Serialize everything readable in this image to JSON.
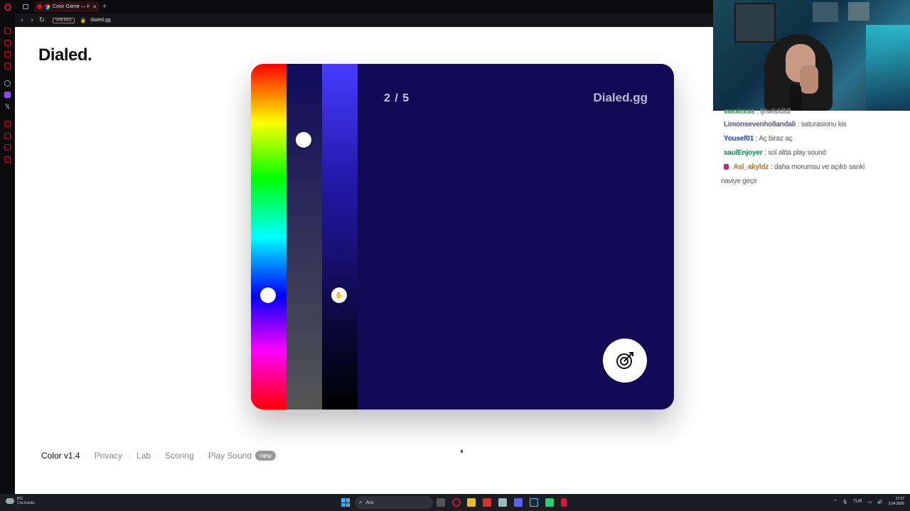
{
  "browser": {
    "tab_title": "Color Game — How W",
    "new_tab": "+",
    "vpn_label": "VPN PRO",
    "url": "dialed.gg"
  },
  "site": {
    "logo": "Dialed."
  },
  "game": {
    "round": "2 / 5",
    "brand": "Dialed.gg",
    "target_color": "#130a56",
    "hue_position": 0.67,
    "saturation_position": 0.22,
    "lightness_position": 0.67
  },
  "footer": {
    "version": "Color v1.4",
    "sep": "·",
    "links": [
      "Privacy",
      "Lab",
      "Scoring",
      "Play Sound"
    ],
    "badge": "new"
  },
  "chat": {
    "messages": [
      {
        "user": "swoinxss",
        "text": ": fjnwfsfdfdf",
        "color": "#3fa34d"
      },
      {
        "user": "Limonsevenhollandali",
        "text": ": saturasionu kis",
        "color": "#6b6b9a"
      },
      {
        "user": "Yousef01",
        "text": ": Aç biraz aç",
        "color": "#2a58c9"
      },
      {
        "user": "saulEnjoyer",
        "text": ": sol altta play sound",
        "color": "#1f9e6e"
      },
      {
        "user": "Asl_akyldz",
        "text": ": daha morumsu ve açıktı sanki",
        "color": "#c98a1a"
      },
      {
        "user": "",
        "text": "naviye geçir",
        "color": "#555555"
      }
    ]
  },
  "taskbar": {
    "temp": "8°C",
    "condition": "Çok bulutlu",
    "search_placeholder": "Ara",
    "lang": "TUR",
    "time": "17:37",
    "date": "3.04.2026"
  }
}
